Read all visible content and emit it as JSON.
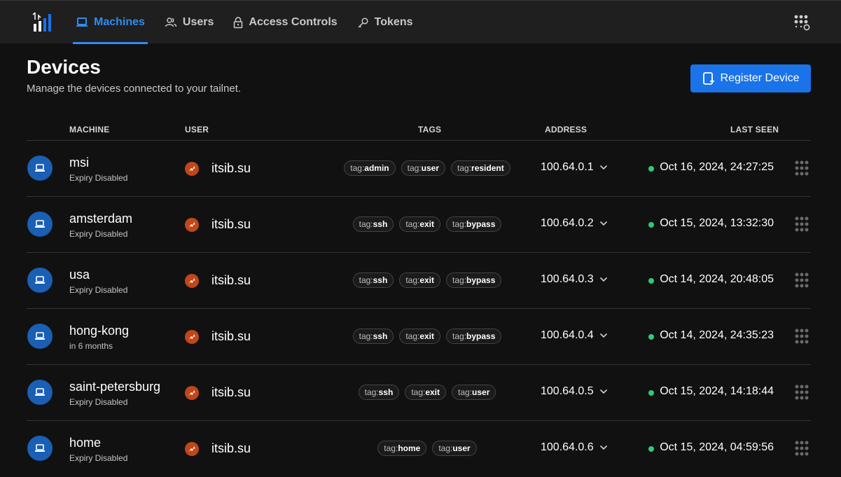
{
  "nav": {
    "items": [
      {
        "label": "Machines",
        "icon": "laptop-icon",
        "active": true
      },
      {
        "label": "Users",
        "icon": "users-icon",
        "active": false
      },
      {
        "label": "Access Controls",
        "icon": "lock-icon",
        "active": false
      },
      {
        "label": "Tokens",
        "icon": "key-icon",
        "active": false
      }
    ]
  },
  "header": {
    "title": "Devices",
    "subtitle": "Manage the devices connected to your tailnet.",
    "register_label": "Register Device"
  },
  "table": {
    "columns": {
      "machine": "MACHINE",
      "user": "USER",
      "tags": "TAGS",
      "address": "ADDRESS",
      "last_seen": "LAST SEEN"
    },
    "rows": [
      {
        "name": "msi",
        "expiry": "Expiry Disabled",
        "user": "itsib.su",
        "tags": [
          {
            "prefix": "tag:",
            "value": "admin"
          },
          {
            "prefix": "tag:",
            "value": "user"
          },
          {
            "prefix": "tag:",
            "value": "resident"
          }
        ],
        "address": "100.64.0.1",
        "last_seen": "Oct 16, 2024, 24:27:25",
        "online": true
      },
      {
        "name": "amsterdam",
        "expiry": "Expiry Disabled",
        "user": "itsib.su",
        "tags": [
          {
            "prefix": "tag:",
            "value": "ssh"
          },
          {
            "prefix": "tag:",
            "value": "exit"
          },
          {
            "prefix": "tag:",
            "value": "bypass"
          }
        ],
        "address": "100.64.0.2",
        "last_seen": "Oct 15, 2024, 13:32:30",
        "online": true
      },
      {
        "name": "usa",
        "expiry": "Expiry Disabled",
        "user": "itsib.su",
        "tags": [
          {
            "prefix": "tag:",
            "value": "ssh"
          },
          {
            "prefix": "tag:",
            "value": "exit"
          },
          {
            "prefix": "tag:",
            "value": "bypass"
          }
        ],
        "address": "100.64.0.3",
        "last_seen": "Oct 14, 2024, 20:48:05",
        "online": true
      },
      {
        "name": "hong-kong",
        "expiry": "in 6 months",
        "user": "itsib.su",
        "tags": [
          {
            "prefix": "tag:",
            "value": "ssh"
          },
          {
            "prefix": "tag:",
            "value": "exit"
          },
          {
            "prefix": "tag:",
            "value": "bypass"
          }
        ],
        "address": "100.64.0.4",
        "last_seen": "Oct 14, 2024, 24:35:23",
        "online": true
      },
      {
        "name": "saint-petersburg",
        "expiry": "Expiry Disabled",
        "user": "itsib.su",
        "tags": [
          {
            "prefix": "tag:",
            "value": "ssh"
          },
          {
            "prefix": "tag:",
            "value": "exit"
          },
          {
            "prefix": "tag:",
            "value": "user"
          }
        ],
        "address": "100.64.0.5",
        "last_seen": "Oct 15, 2024, 14:18:44",
        "online": true
      },
      {
        "name": "home",
        "expiry": "Expiry Disabled",
        "user": "itsib.su",
        "tags": [
          {
            "prefix": "tag:",
            "value": "home"
          },
          {
            "prefix": "tag:",
            "value": "user"
          }
        ],
        "address": "100.64.0.6",
        "last_seen": "Oct 15, 2024, 04:59:56",
        "online": true
      }
    ]
  },
  "colors": {
    "accent": "#1a73e8",
    "nav_active": "#2f8bf0",
    "device_icon_bg": "#1a5fb4",
    "user_icon_bg": "#c0461b",
    "online": "#2ecc71",
    "background": "#111111",
    "topbar": "#1f1f1f"
  }
}
